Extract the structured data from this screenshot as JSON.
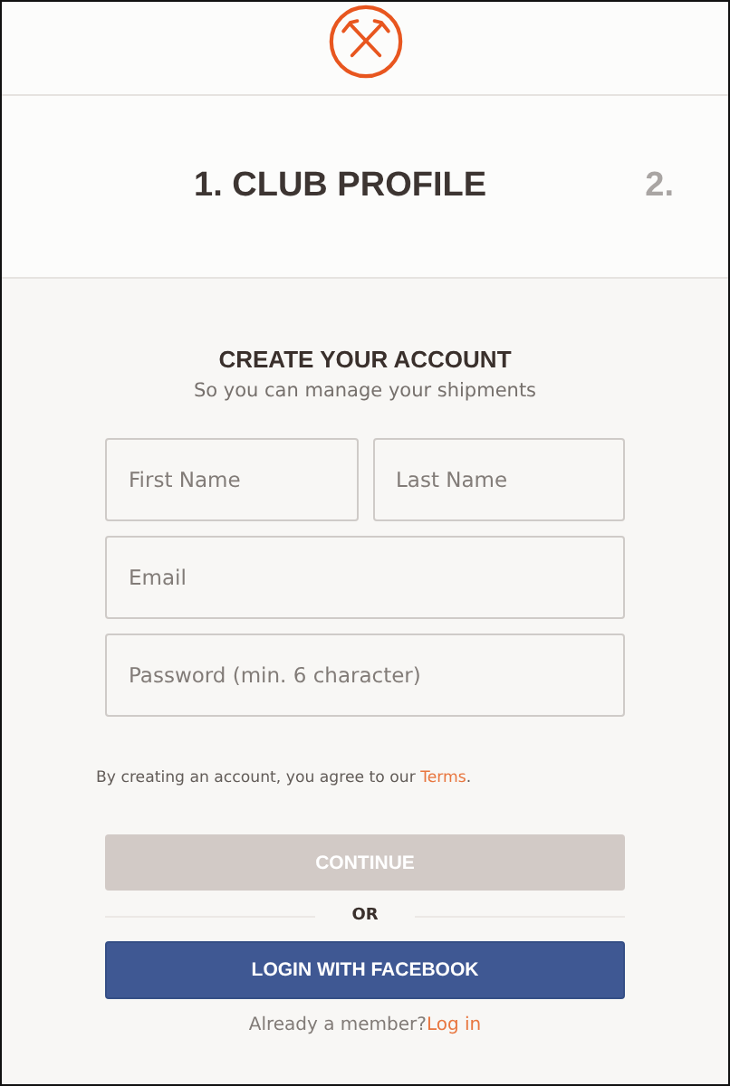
{
  "steps": [
    {
      "label": "1. CLUB PROFILE",
      "selected": true
    },
    {
      "label": "2.",
      "selected": false
    }
  ],
  "form": {
    "title": "CREATE YOUR ACCOUNT",
    "subtitle": "So you can manage your shipments",
    "fields": [
      {
        "placeholder": "First Name"
      },
      {
        "placeholder": "Last Name"
      },
      {
        "placeholder": "Email"
      },
      {
        "placeholder": "Password (min. 6 character)"
      }
    ],
    "terms": {
      "text": "By creating an account, you agree to our ",
      "link": "Terms",
      "after": "."
    },
    "continue_button": {
      "label": "CONTINUE",
      "disabled": true
    },
    "divider": "OR",
    "facebook_button": "LOGIN WITH FACEBOOK",
    "member": {
      "text": "Already a member?",
      "link": "Log in"
    }
  }
}
